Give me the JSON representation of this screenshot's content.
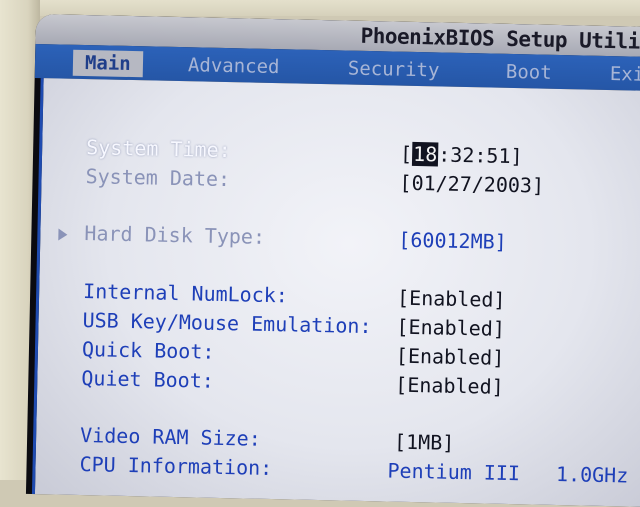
{
  "title": "PhoenixBIOS Setup Utility",
  "tabs": [
    {
      "label": "Main"
    },
    {
      "label": "Advanced"
    },
    {
      "label": "Security"
    },
    {
      "label": "Boot"
    },
    {
      "label": "Exit"
    }
  ],
  "active_tab": "Main",
  "settings": {
    "system_time": {
      "label": "System Time:",
      "value_prefix": "[",
      "cursor_field": "18",
      "value_rest": ":32:51]"
    },
    "system_date": {
      "label": "System Date:",
      "value": "[01/27/2003]"
    },
    "hard_disk_type": {
      "label": "Hard Disk Type:",
      "value": "[60012MB]"
    },
    "internal_numlock": {
      "label": "Internal NumLock:",
      "value": "[Enabled]"
    },
    "usb_emulation": {
      "label": "USB Key/Mouse Emulation:",
      "value": "[Enabled]"
    },
    "quick_boot": {
      "label": "Quick Boot:",
      "value": "[Enabled]"
    },
    "quiet_boot": {
      "label": "Quiet Boot:",
      "value": "[Enabled]"
    },
    "video_ram": {
      "label": "Video RAM Size:",
      "value": "[1MB]"
    },
    "cpu_info": {
      "label": "CPU Information:",
      "value": "Pentium III   1.0GHz"
    }
  },
  "icons": {
    "submenu": "triangle-right-icon"
  },
  "colors": {
    "menu_bar": "#2c62b9",
    "title_bar": "#b9bbc5",
    "panel": "#e8eaf1",
    "selected_label": "#f7f8ff",
    "item_label": "#1e3fb8",
    "readonly_label": "#8a93b8",
    "value_text": "#111320"
  }
}
